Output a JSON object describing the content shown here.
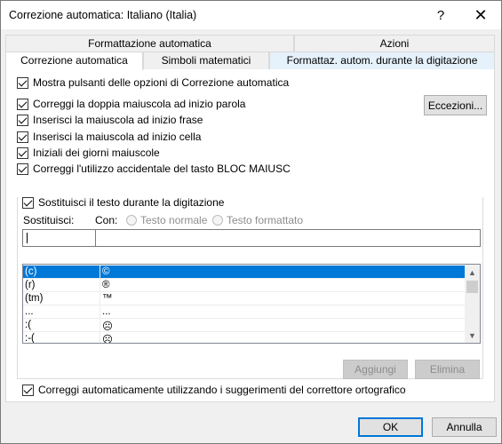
{
  "window": {
    "title": "Correzione automatica: Italiano (Italia)",
    "help_label": "?",
    "close_label": "✕"
  },
  "tabs_row1": [
    {
      "label": "Formattazione automatica"
    },
    {
      "label": "Azioni"
    }
  ],
  "tabs_row2": [
    {
      "label": "Correzione automatica",
      "active": true
    },
    {
      "label": "Simboli matematici"
    },
    {
      "label": "Formattaz. autom. durante la digitazione"
    }
  ],
  "options": {
    "show_buttons": {
      "label": "Mostra pulsanti delle opzioni di Correzione automatica",
      "checked": true
    },
    "items": [
      {
        "label": "Correggi la doppia maiuscola ad inizio parola",
        "checked": true
      },
      {
        "label": "Inserisci la maiuscola ad inizio frase",
        "checked": true
      },
      {
        "label": "Inserisci la maiuscola ad inizio cella",
        "checked": true
      },
      {
        "label": "Iniziali dei giorni maiuscole",
        "checked": true
      },
      {
        "label": "Correggi l'utilizzo accidentale del tasto BLOC MAIUSC",
        "checked": true
      }
    ],
    "exceptions_button": "Eccezioni..."
  },
  "replace": {
    "checkbox_label": "Sostituisci il testo durante la digitazione",
    "checked": true,
    "replace_label": "Sostituisci:",
    "with_label": "Con:",
    "radio_plain": "Testo normale",
    "radio_formatted": "Testo formattato",
    "replace_value": "",
    "with_value": ""
  },
  "list": {
    "rows": [
      {
        "from": "(c)",
        "to": "©",
        "selected": true
      },
      {
        "from": "(r)",
        "to": "®",
        "selected": false
      },
      {
        "from": "(tm)",
        "to": "™",
        "selected": false
      },
      {
        "from": "...",
        "to": "...",
        "selected": false
      },
      {
        "from": ":(",
        "to": "☹",
        "selected": false
      },
      {
        "from": ":-(",
        "to": "☹",
        "selected": false
      }
    ],
    "scroll_up": "▲",
    "scroll_down": "▼"
  },
  "buttons": {
    "add": "Aggiungi",
    "delete": "Elimina",
    "ok": "OK",
    "cancel": "Annulla"
  },
  "spellcheck": {
    "label": "Correggi automaticamente utilizzando i suggerimenti del correttore ortografico",
    "checked": true
  }
}
